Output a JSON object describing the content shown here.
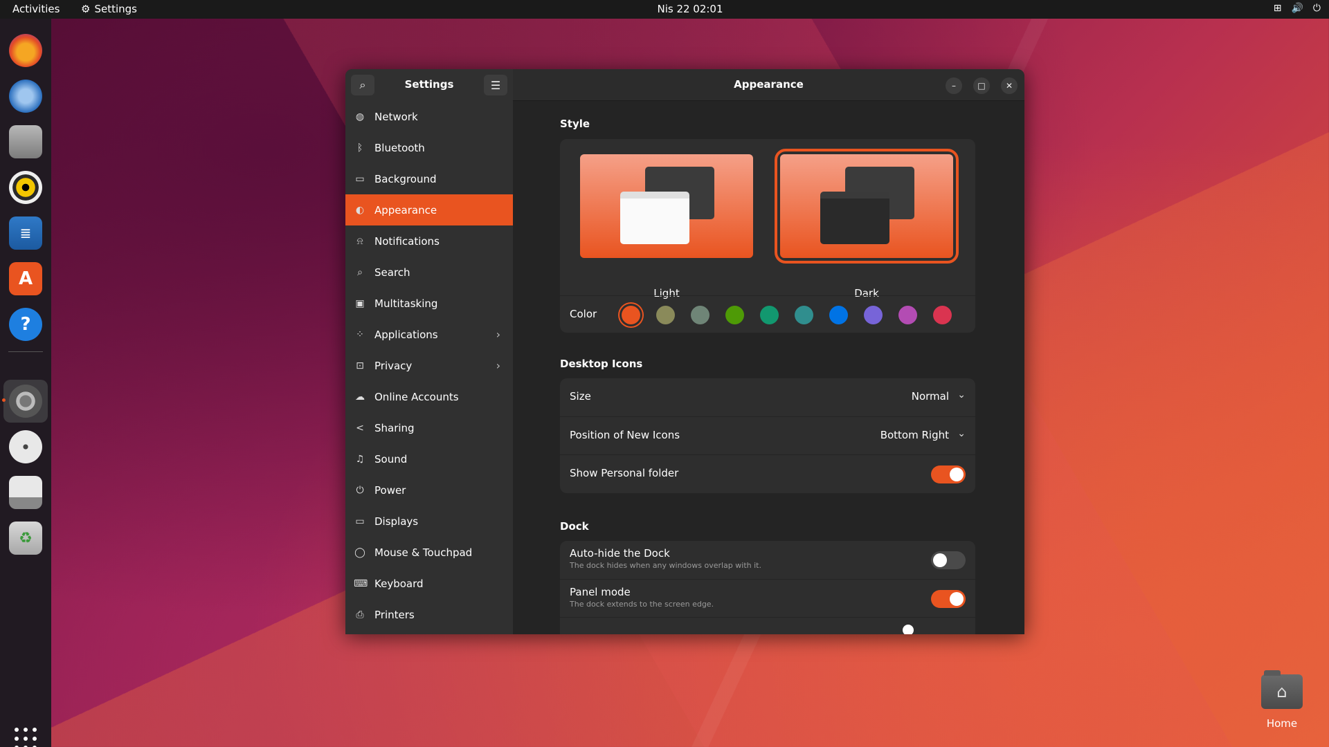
{
  "topbar": {
    "activities": "Activities",
    "app_name": "Settings",
    "clock": "Nis 22  02:01"
  },
  "dock": {
    "items": [
      "firefox",
      "thunderbird",
      "files",
      "rhythmbox",
      "libreoffice-writer",
      "app-center",
      "help",
      "settings",
      "disc",
      "save",
      "trash"
    ]
  },
  "desktop": {
    "home_label": "Home"
  },
  "sidebar": {
    "title": "Settings",
    "items": [
      {
        "label": "Network",
        "icon": "network-icon"
      },
      {
        "label": "Bluetooth",
        "icon": "bluetooth-icon"
      },
      {
        "label": "Background",
        "icon": "background-icon"
      },
      {
        "label": "Appearance",
        "icon": "appearance-icon",
        "active": true
      },
      {
        "label": "Notifications",
        "icon": "bell-icon"
      },
      {
        "label": "Search",
        "icon": "search-icon"
      },
      {
        "label": "Multitasking",
        "icon": "multitasking-icon"
      },
      {
        "label": "Applications",
        "icon": "apps-icon",
        "chevron": true
      },
      {
        "label": "Privacy",
        "icon": "lock-icon",
        "chevron": true
      },
      {
        "label": "Online Accounts",
        "icon": "cloud-icon"
      },
      {
        "label": "Sharing",
        "icon": "share-icon"
      },
      {
        "label": "Sound",
        "icon": "music-icon"
      },
      {
        "label": "Power",
        "icon": "power-icon"
      },
      {
        "label": "Displays",
        "icon": "display-icon"
      },
      {
        "label": "Mouse & Touchpad",
        "icon": "mouse-icon"
      },
      {
        "label": "Keyboard",
        "icon": "keyboard-icon"
      },
      {
        "label": "Printers",
        "icon": "printer-icon"
      }
    ]
  },
  "content": {
    "title": "Appearance",
    "style": {
      "section": "Style",
      "light_label": "Light",
      "dark_label": "Dark",
      "selected": "Dark",
      "color_label": "Color",
      "colors": [
        "#e95420",
        "#8a8a5a",
        "#6f8577",
        "#4e9a06",
        "#12986f",
        "#308e8e",
        "#0073e5",
        "#7764d8",
        "#b34cb3",
        "#da3450"
      ],
      "selected_color": "#e95420"
    },
    "desktop_icons": {
      "section": "Desktop Icons",
      "size_label": "Size",
      "size_value": "Normal",
      "position_label": "Position of New Icons",
      "position_value": "Bottom Right",
      "personal_label": "Show Personal folder",
      "personal_on": true
    },
    "dock": {
      "section": "Dock",
      "autohide_label": "Auto-hide the Dock",
      "autohide_sub": "The dock hides when any windows overlap with it.",
      "autohide_on": false,
      "panel_label": "Panel mode",
      "panel_sub": "The dock extends to the screen edge.",
      "panel_on": true
    }
  },
  "colors": {
    "accent": "#e95420",
    "window_bg": "#242424",
    "sidebar_bg": "#303030",
    "card_bg": "#2e2e2e"
  }
}
